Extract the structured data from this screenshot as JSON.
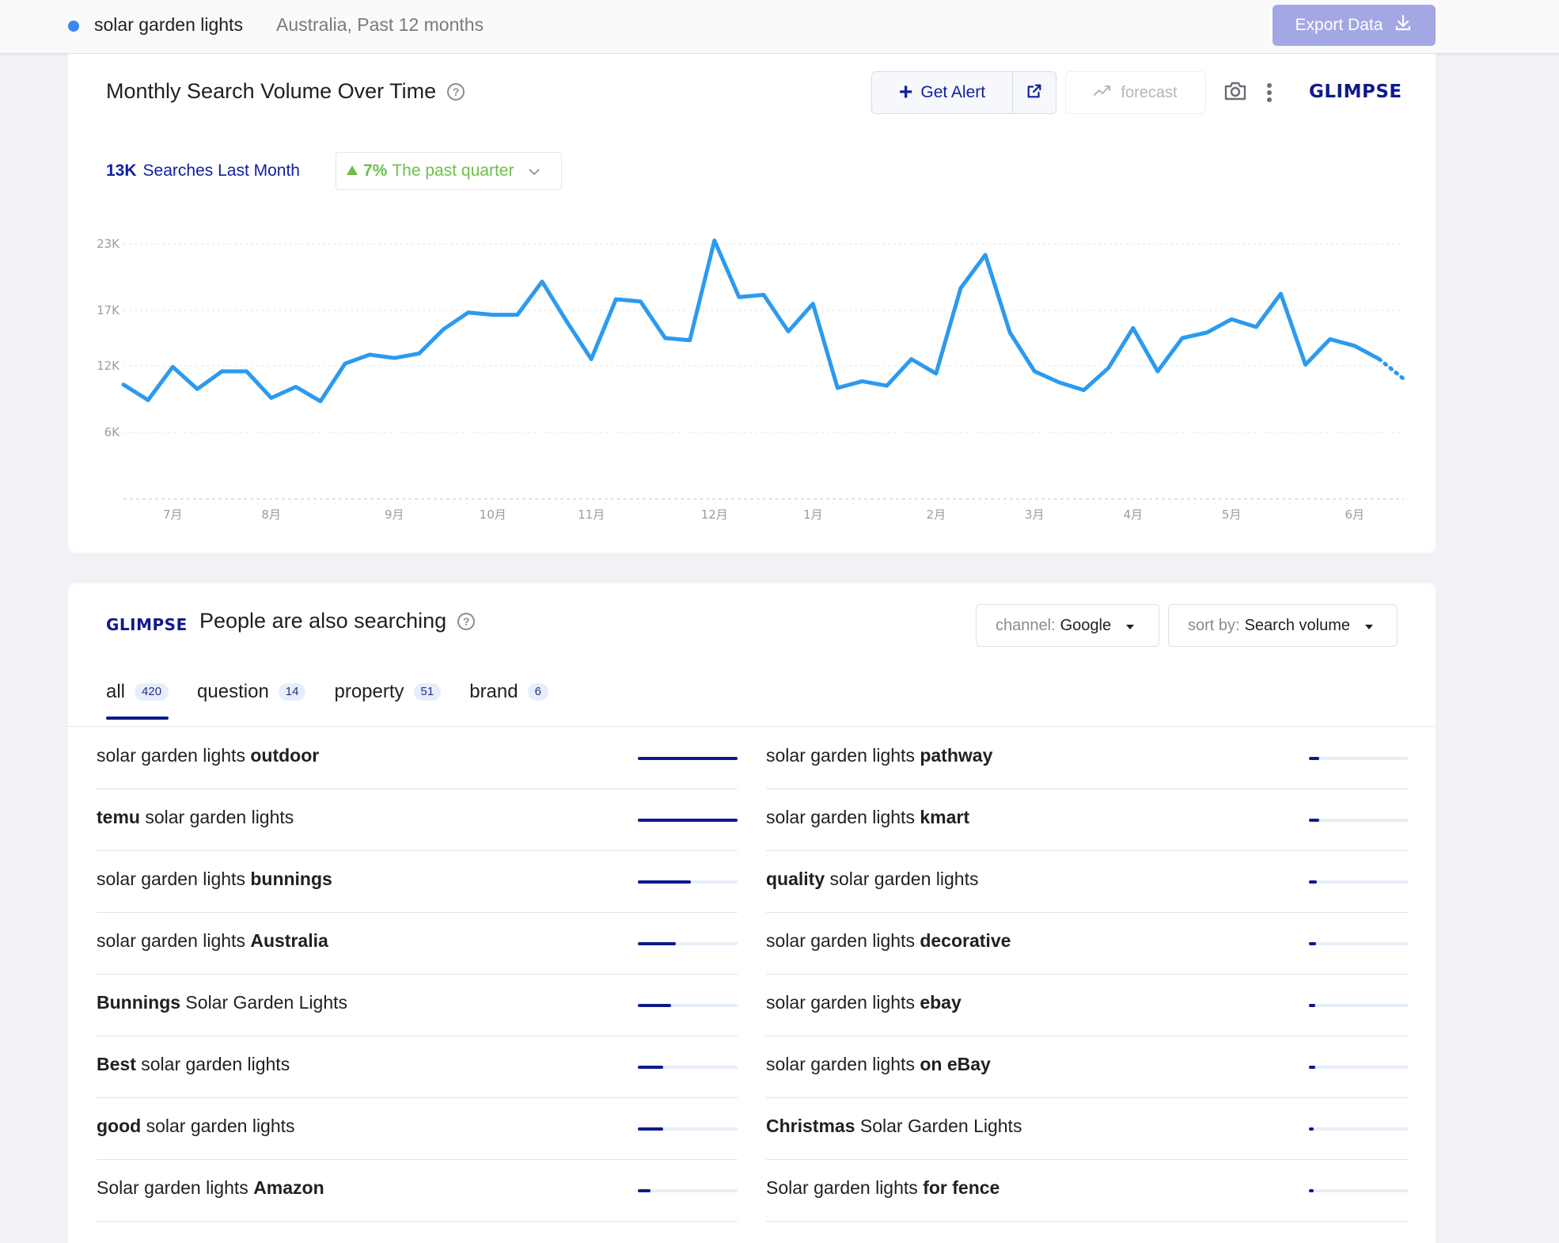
{
  "header": {
    "term": "solar garden lights",
    "meta": "Australia, Past 12 months",
    "export_label": "Export Data",
    "dot_color": "#3d86f0"
  },
  "volume_card": {
    "title": "Monthly Search Volume Over Time",
    "get_alert_label": "Get Alert",
    "forecast_label": "forecast",
    "logo_text": "GLIMPSE",
    "stat_value": "13K",
    "stat_label": "Searches Last Month",
    "quarter_change": "7%",
    "quarter_label": "The past quarter",
    "accent_color": "#0e1fa3",
    "positive_color": "#6cbf4c",
    "line_color": "#2b9af0"
  },
  "chart_data": {
    "type": "line",
    "title": "",
    "xlabel": "",
    "ylabel": "",
    "grid": true,
    "ylim": [
      0,
      24000
    ],
    "y_ticks": [
      {
        "value": 6000,
        "label": "6K"
      },
      {
        "value": 12000,
        "label": "12K"
      },
      {
        "value": 17000,
        "label": "17K"
      },
      {
        "value": 23000,
        "label": "23K"
      }
    ],
    "x_ticks": [
      {
        "index": 2,
        "label": "7月"
      },
      {
        "index": 6,
        "label": "8月"
      },
      {
        "index": 11,
        "label": "9月"
      },
      {
        "index": 15,
        "label": "10月"
      },
      {
        "index": 19,
        "label": "11月"
      },
      {
        "index": 24,
        "label": "12月"
      },
      {
        "index": 28,
        "label": "1月"
      },
      {
        "index": 33,
        "label": "2月"
      },
      {
        "index": 37,
        "label": "3月"
      },
      {
        "index": 41,
        "label": "4月"
      },
      {
        "index": 45,
        "label": "5月"
      },
      {
        "index": 50,
        "label": "6月"
      }
    ],
    "series": [
      {
        "values": [
          10300,
          8900,
          11900,
          9900,
          11500,
          11500,
          9100,
          10100,
          8800,
          12200,
          13000,
          12700,
          13100,
          15300,
          16800,
          16600,
          16600,
          19600,
          16000,
          12600,
          18000,
          17800,
          14500,
          14300,
          23300,
          18200,
          18400,
          15100,
          17600,
          10000,
          10600,
          10200,
          12600,
          11300,
          19000,
          22000,
          15000,
          11500,
          10500,
          9800,
          11800,
          15400,
          11500,
          14500,
          15000,
          16200,
          15500,
          18500,
          12100,
          14400,
          13800,
          12600
        ],
        "forecast_values": [
          12600,
          10800
        ]
      }
    ]
  },
  "related_card": {
    "logo_text": "GLIMPSE",
    "title": "People are also searching",
    "channel_label": "channel:",
    "channel_value": "Google",
    "sort_label": "sort by:",
    "sort_value": "Search volume",
    "tabs": [
      {
        "label": "all",
        "count": "420"
      },
      {
        "label": "question",
        "count": "14"
      },
      {
        "label": "property",
        "count": "51"
      },
      {
        "label": "brand",
        "count": "6"
      }
    ],
    "left_rows": [
      {
        "pre": "solar garden lights ",
        "bold": "outdoor",
        "post": "",
        "level": 1.0
      },
      {
        "pre": "",
        "bold": "temu",
        "post": " solar garden lights",
        "level": 1.0
      },
      {
        "pre": "solar garden lights ",
        "bold": "bunnings",
        "post": "",
        "level": 0.53
      },
      {
        "pre": "solar garden lights ",
        "bold": "Australia",
        "post": "",
        "level": 0.38
      },
      {
        "pre": "",
        "bold": "Bunnings",
        "post": " Solar Garden Lights",
        "level": 0.33
      },
      {
        "pre": "",
        "bold": "Best",
        "post": " solar garden lights",
        "level": 0.25
      },
      {
        "pre": "",
        "bold": "good",
        "post": " solar garden lights",
        "level": 0.25
      },
      {
        "pre": "Solar garden lights ",
        "bold": "Amazon",
        "post": "",
        "level": 0.13
      }
    ],
    "right_rows": [
      {
        "pre": "solar garden lights ",
        "bold": "pathway",
        "post": "",
        "level": 0.1
      },
      {
        "pre": "solar garden lights ",
        "bold": "kmart",
        "post": "",
        "level": 0.1
      },
      {
        "pre": "",
        "bold": "quality",
        "post": " solar garden lights",
        "level": 0.08
      },
      {
        "pre": "solar garden lights ",
        "bold": "decorative",
        "post": "",
        "level": 0.07
      },
      {
        "pre": "solar garden lights ",
        "bold": "ebay",
        "post": "",
        "level": 0.06
      },
      {
        "pre": "solar garden lights ",
        "bold": "on eBay",
        "post": "",
        "level": 0.06
      },
      {
        "pre": "",
        "bold": "Christmas",
        "post": " Solar Garden Lights",
        "level": 0.05
      },
      {
        "pre": "Solar garden lights ",
        "bold": "for fence",
        "post": "",
        "level": 0.05
      }
    ]
  }
}
